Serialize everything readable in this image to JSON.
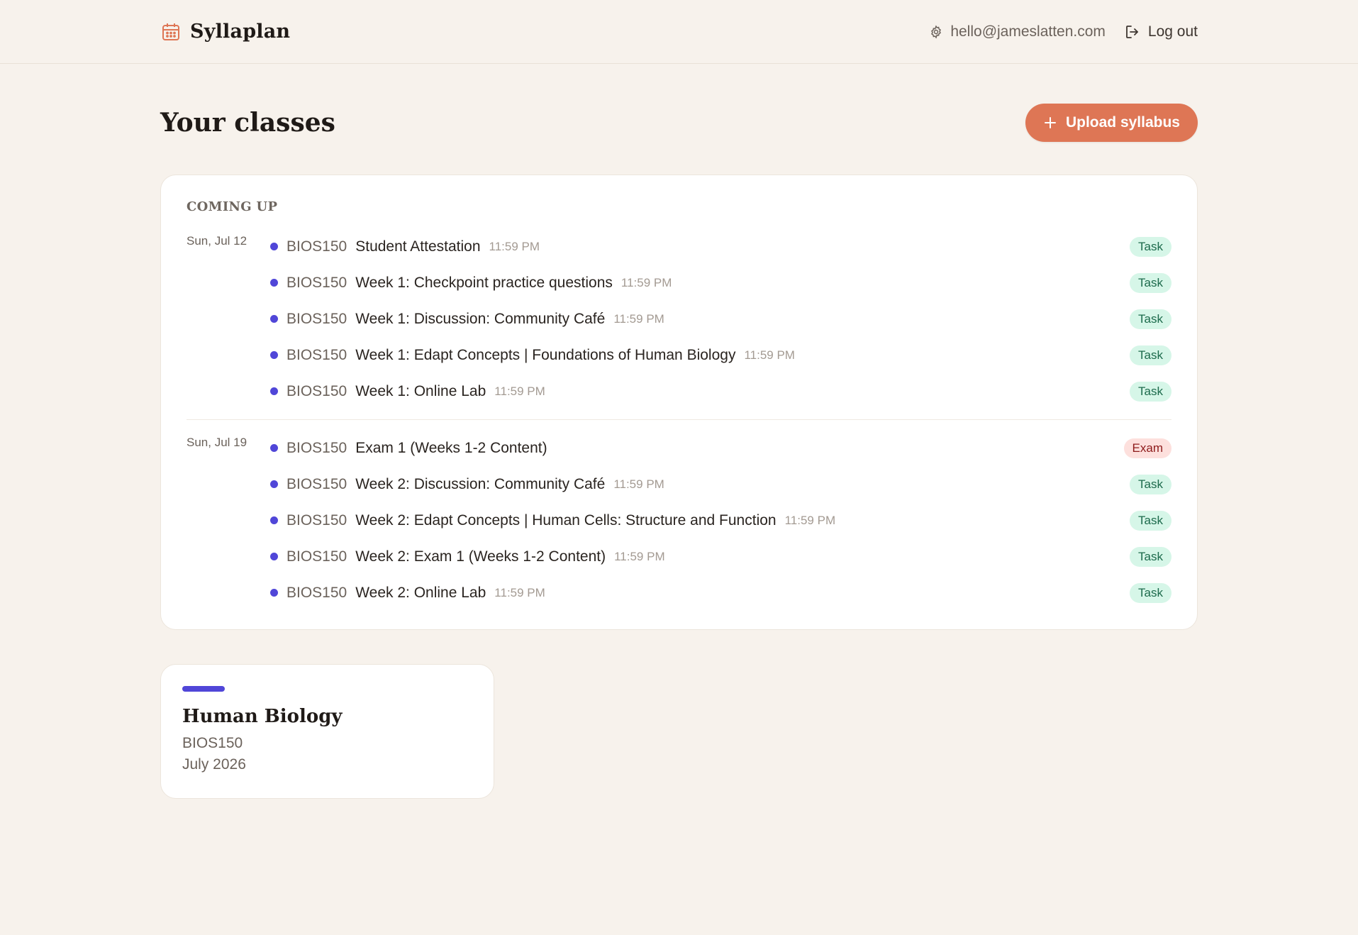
{
  "header": {
    "brand": "Syllaplan",
    "email": "hello@jameslatten.com",
    "logout_label": "Log out"
  },
  "main": {
    "title": "Your classes",
    "upload_label": "Upload syllabus"
  },
  "upcoming": {
    "title": "COMING UP",
    "groups": [
      {
        "date": "Sun, Jul 12",
        "items": [
          {
            "code": "BIOS150",
            "name": "Student Attestation",
            "time": "11:59 PM",
            "badge": "Task"
          },
          {
            "code": "BIOS150",
            "name": "Week 1: Checkpoint practice questions",
            "time": "11:59 PM",
            "badge": "Task"
          },
          {
            "code": "BIOS150",
            "name": "Week 1: Discussion: Community Café",
            "time": "11:59 PM",
            "badge": "Task"
          },
          {
            "code": "BIOS150",
            "name": "Week 1: Edapt Concepts | Foundations of Human Biology",
            "time": "11:59 PM",
            "badge": "Task"
          },
          {
            "code": "BIOS150",
            "name": "Week 1: Online Lab",
            "time": "11:59 PM",
            "badge": "Task"
          }
        ]
      },
      {
        "date": "Sun, Jul 19",
        "items": [
          {
            "code": "BIOS150",
            "name": "Exam 1 (Weeks 1-2 Content)",
            "time": "",
            "badge": "Exam"
          },
          {
            "code": "BIOS150",
            "name": "Week 2: Discussion: Community Café",
            "time": "11:59 PM",
            "badge": "Task"
          },
          {
            "code": "BIOS150",
            "name": "Week 2: Edapt Concepts | Human Cells: Structure and Function",
            "time": "11:59 PM",
            "badge": "Task"
          },
          {
            "code": "BIOS150",
            "name": "Week 2: Exam 1 (Weeks 1-2 Content)",
            "time": "11:59 PM",
            "badge": "Task"
          },
          {
            "code": "BIOS150",
            "name": "Week 2: Online Lab",
            "time": "11:59 PM",
            "badge": "Task"
          }
        ]
      }
    ]
  },
  "classes": [
    {
      "name": "Human Biology",
      "code": "BIOS150",
      "term": "July 2026",
      "color": "#5046d8"
    }
  ],
  "colors": {
    "accent": "#de7655",
    "course_dot": "#5046d8",
    "task_badge_bg": "#d6f6e8",
    "exam_badge_bg": "#fde0dd"
  }
}
